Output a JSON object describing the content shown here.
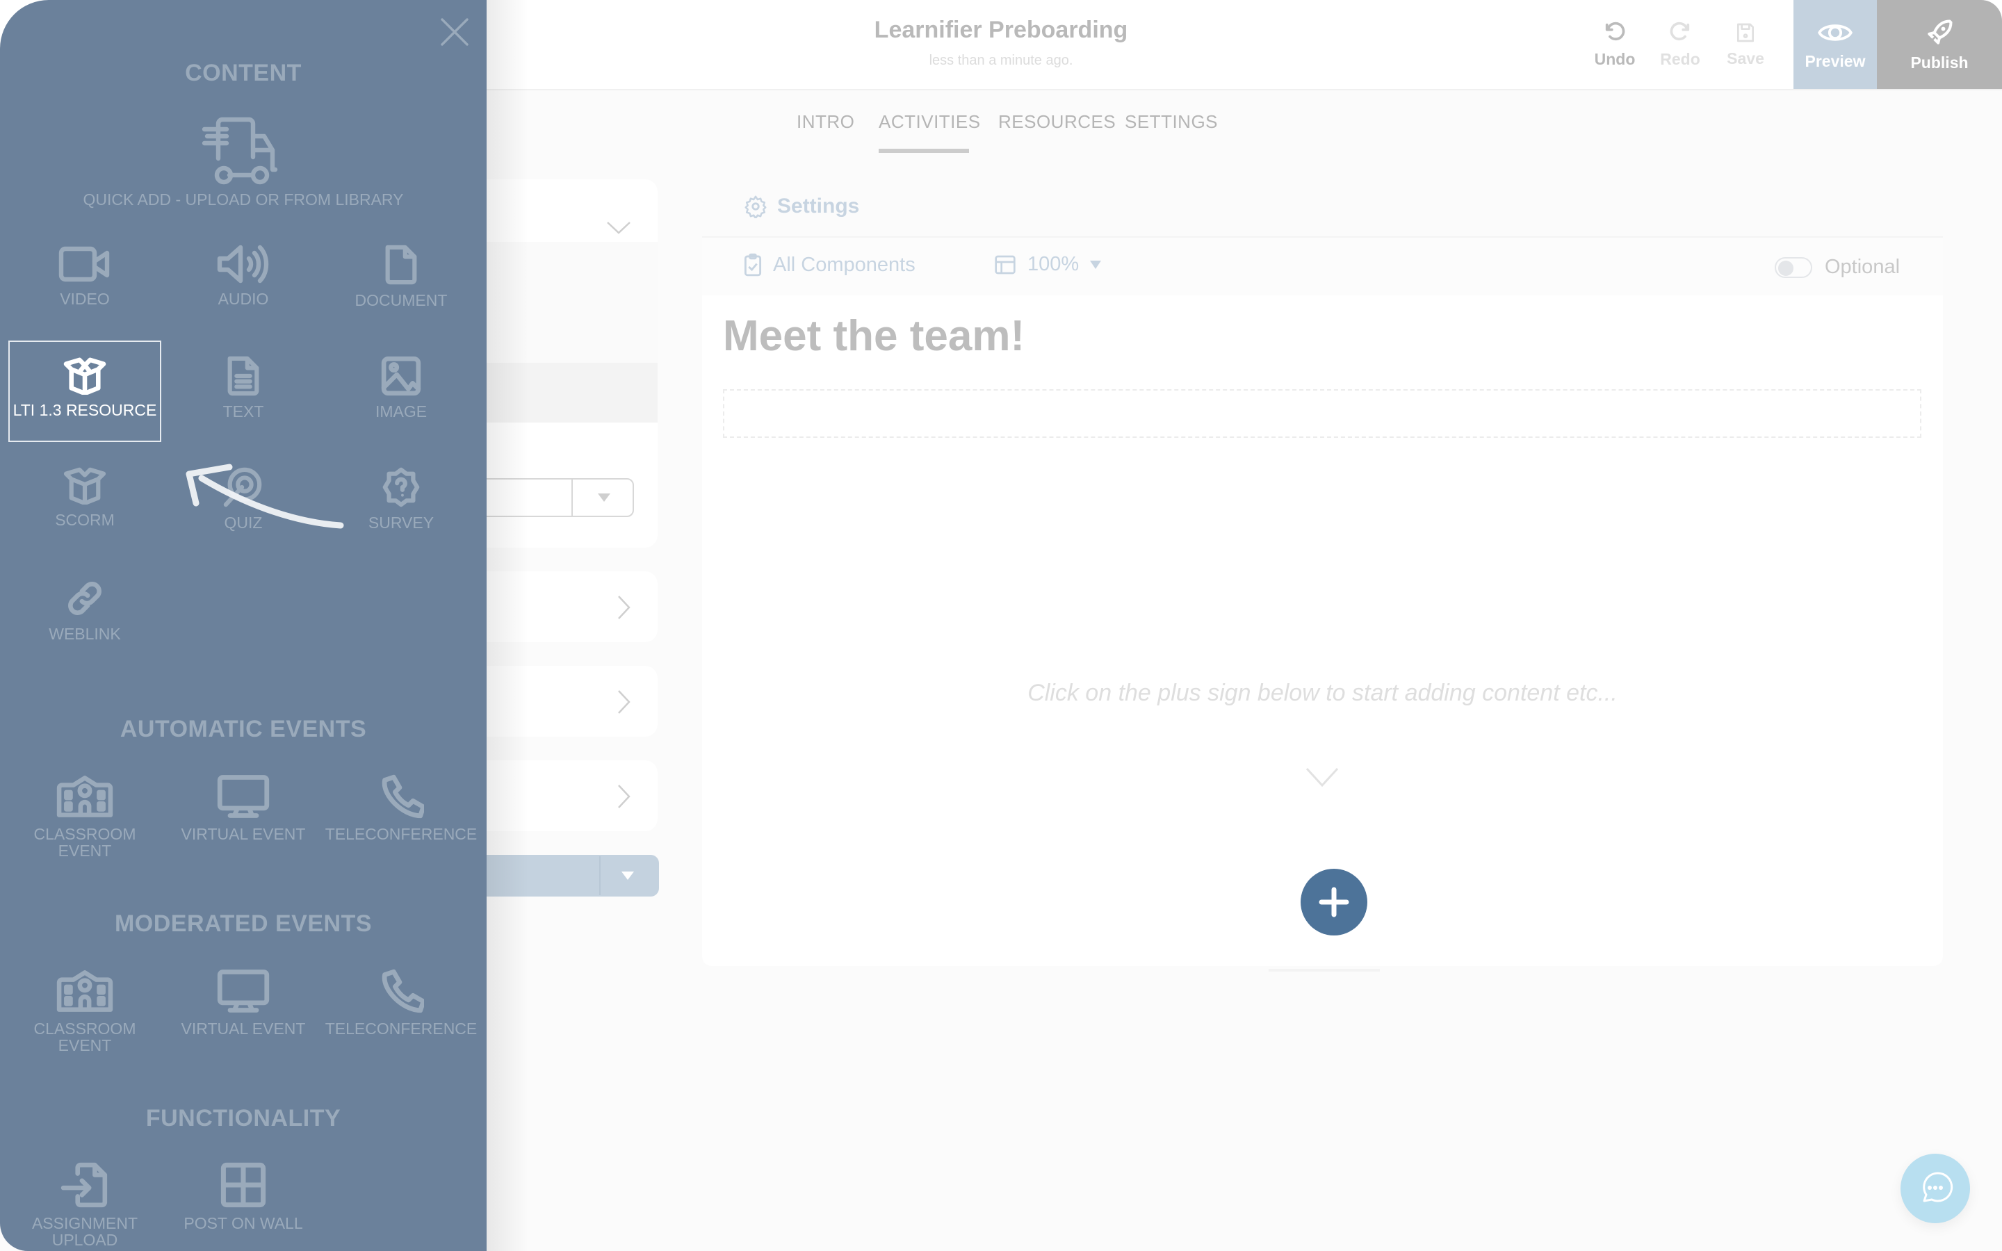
{
  "header": {
    "title": "Learnifier Preboarding",
    "subtitle": "less than a minute ago.",
    "actions": {
      "undo": "Undo",
      "redo": "Redo",
      "save": "Save",
      "preview": "Preview",
      "publish": "Publish"
    }
  },
  "tabs": [
    {
      "label": "INTRO",
      "active": false
    },
    {
      "label": "ACTIVITIES",
      "active": true
    },
    {
      "label": "RESOURCES",
      "active": false
    },
    {
      "label": "SETTINGS",
      "active": false
    }
  ],
  "editor": {
    "settings_label": "Settings",
    "components_label": "All Components",
    "zoom_value": "100%",
    "optional_label": "Optional",
    "optional_on": false,
    "heading": "Meet the team!",
    "hint": "Click on the plus sign below to start adding content etc..."
  },
  "panel": {
    "close_icon": "close-icon",
    "sections": {
      "content": {
        "title": "CONTENT",
        "quick_add": "QUICK ADD - UPLOAD OR FROM LIBRARY",
        "items": [
          {
            "label": "VIDEO",
            "icon": "video-icon"
          },
          {
            "label": "AUDIO",
            "icon": "audio-icon"
          },
          {
            "label": "DOCUMENT",
            "icon": "document-icon"
          },
          {
            "label": "LTI 1.3 RESOURCE",
            "icon": "box-icon",
            "selected": true
          },
          {
            "label": "TEXT",
            "icon": "text-file-icon"
          },
          {
            "label": "IMAGE",
            "icon": "image-icon"
          },
          {
            "label": "SCORM",
            "icon": "box-icon"
          },
          {
            "label": "QUIZ",
            "icon": "target-icon"
          },
          {
            "label": "SURVEY",
            "icon": "question-badge-icon"
          },
          {
            "label": "WEBLINK",
            "icon": "link-icon"
          }
        ]
      },
      "automatic": {
        "title": "AUTOMATIC EVENTS",
        "items": [
          {
            "label": "CLASSROOM EVENT",
            "icon": "school-icon"
          },
          {
            "label": "VIRTUAL EVENT",
            "icon": "monitor-icon"
          },
          {
            "label": "TELECONFERENCE",
            "icon": "phone-icon"
          }
        ]
      },
      "moderated": {
        "title": "MODERATED EVENTS",
        "items": [
          {
            "label": "CLASSROOM EVENT",
            "icon": "school-icon"
          },
          {
            "label": "VIRTUAL EVENT",
            "icon": "monitor-icon"
          },
          {
            "label": "TELECONFERENCE",
            "icon": "phone-icon"
          }
        ]
      },
      "functionality": {
        "title": "FUNCTIONALITY",
        "items": [
          {
            "label": "ASSIGNMENT UPLOAD",
            "icon": "file-import-icon"
          },
          {
            "label": "POST ON WALL",
            "icon": "grid-icon"
          }
        ]
      }
    }
  },
  "colors": {
    "panel": "#6b819b",
    "panel_text": "#9aaabb",
    "accent": "#4d7399",
    "preview_bg": "#c4d2df",
    "publish_bg": "#b3b3b3",
    "chat_bg": "#b8dff0"
  }
}
